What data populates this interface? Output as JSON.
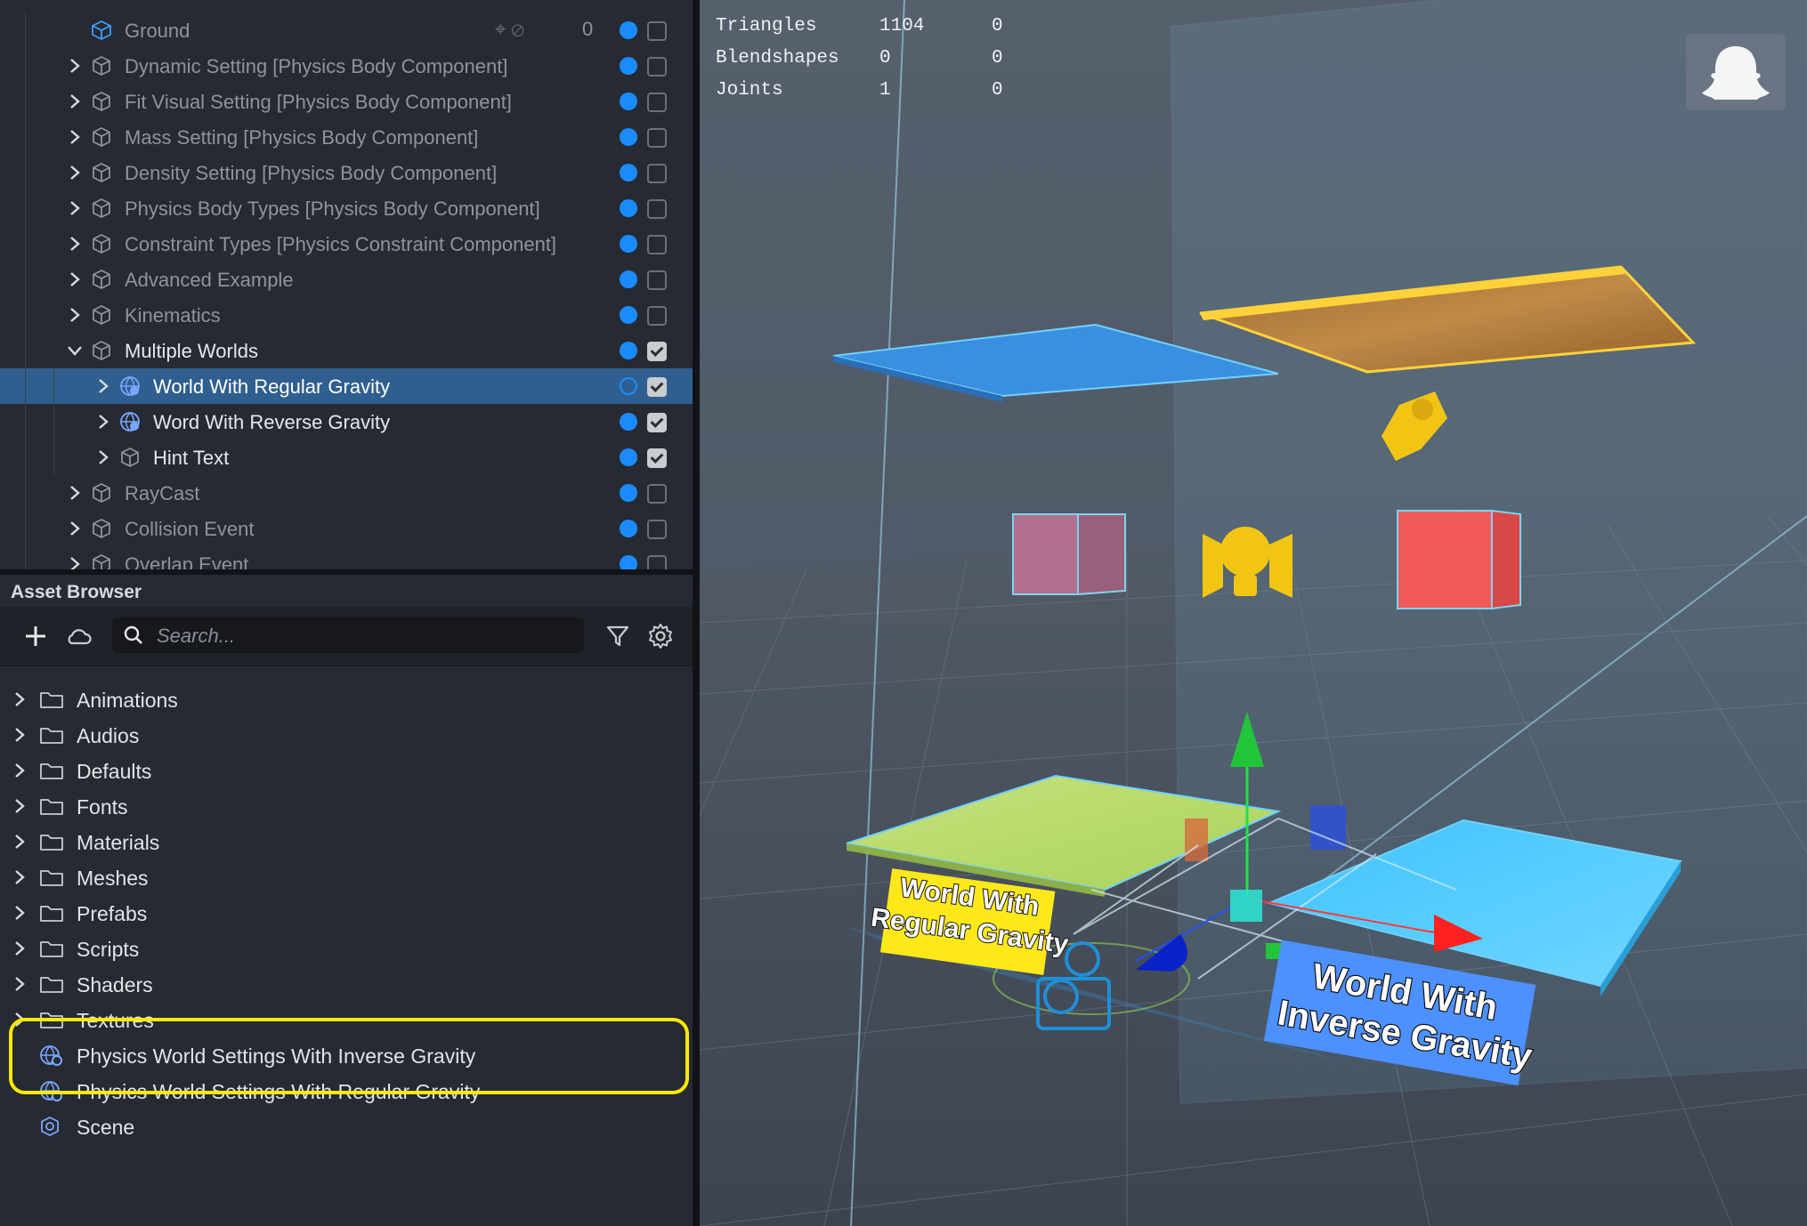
{
  "hierarchy": {
    "rows": [
      {
        "label": "Ground",
        "depth": 1,
        "arrow": "none",
        "icon": "mesh-cube",
        "active": false,
        "count": "0",
        "checked": false
      },
      {
        "label": "Dynamic Setting [Physics Body Component]",
        "depth": 1,
        "arrow": "right",
        "icon": "scene-object",
        "active": false,
        "checked": false
      },
      {
        "label": "Fit Visual Setting [Physics Body Component]",
        "depth": 1,
        "arrow": "right",
        "icon": "scene-object",
        "active": false,
        "checked": false
      },
      {
        "label": "Mass Setting [Physics Body Component]",
        "depth": 1,
        "arrow": "right",
        "icon": "scene-object",
        "active": false,
        "checked": false
      },
      {
        "label": "Density Setting [Physics Body Component]",
        "depth": 1,
        "arrow": "right",
        "icon": "scene-object",
        "active": false,
        "checked": false
      },
      {
        "label": "Physics Body Types [Physics Body Component]",
        "depth": 1,
        "arrow": "right",
        "icon": "scene-object",
        "active": false,
        "checked": false
      },
      {
        "label": "Constraint Types [Physics Constraint Component]",
        "depth": 1,
        "arrow": "right",
        "icon": "scene-object",
        "active": false,
        "checked": false
      },
      {
        "label": "Advanced Example",
        "depth": 1,
        "arrow": "right",
        "icon": "scene-object",
        "active": false,
        "checked": false
      },
      {
        "label": "Kinematics",
        "depth": 1,
        "arrow": "right",
        "icon": "scene-object",
        "active": false,
        "checked": false
      },
      {
        "label": "Multiple Worlds",
        "depth": 1,
        "arrow": "down",
        "icon": "scene-object",
        "active": true,
        "checked": true
      },
      {
        "label": "World With Regular Gravity",
        "depth": 2,
        "arrow": "right",
        "icon": "physics-world",
        "active": true,
        "checked": true,
        "selected": true
      },
      {
        "label": "Word With Reverse Gravity",
        "depth": 2,
        "arrow": "right",
        "icon": "physics-world",
        "active": true,
        "checked": true
      },
      {
        "label": "Hint Text",
        "depth": 2,
        "arrow": "right",
        "icon": "scene-object",
        "active": true,
        "checked": true
      },
      {
        "label": "RayCast",
        "depth": 1,
        "arrow": "right",
        "icon": "scene-object",
        "active": false,
        "checked": false
      },
      {
        "label": "Collision Event",
        "depth": 1,
        "arrow": "right",
        "icon": "scene-object",
        "active": false,
        "checked": false
      },
      {
        "label": "Overlap Event",
        "depth": 1,
        "arrow": "right",
        "icon": "scene-object",
        "active": false,
        "checked": false
      }
    ]
  },
  "asset_browser": {
    "title": "Asset Browser",
    "search_placeholder": "Search...",
    "items": [
      {
        "label": "Animations",
        "type": "folder"
      },
      {
        "label": "Audios",
        "type": "folder"
      },
      {
        "label": "Defaults",
        "type": "folder"
      },
      {
        "label": "Fonts",
        "type": "folder"
      },
      {
        "label": "Materials",
        "type": "folder"
      },
      {
        "label": "Meshes",
        "type": "folder"
      },
      {
        "label": "Prefabs",
        "type": "folder"
      },
      {
        "label": "Scripts",
        "type": "folder"
      },
      {
        "label": "Shaders",
        "type": "folder"
      },
      {
        "label": "Textures",
        "type": "folder"
      },
      {
        "label": "Physics World Settings With Inverse Gravity",
        "type": "physics-settings"
      },
      {
        "label": "Physics World Settings With Regular Gravity",
        "type": "physics-settings"
      },
      {
        "label": "Scene",
        "type": "scene"
      }
    ]
  },
  "viewport": {
    "stats": [
      {
        "name": "Triangles",
        "value": "1104",
        "extra": "0"
      },
      {
        "name": "Blendshapes",
        "value": "0",
        "extra": "0"
      },
      {
        "name": "Joints",
        "value": "1",
        "extra": "0"
      }
    ],
    "label_regular": [
      "World With",
      "Regular Gravity"
    ],
    "label_inverse": [
      "World With",
      "Inverse Gravity"
    ],
    "icons": [
      "snapchat-ghost-icon",
      "light-icon",
      "camera-icon",
      "gizmo-icon"
    ]
  },
  "colors": {
    "selection": "#2f5f8f",
    "accent": "#1a8cff",
    "highlight": "#ffea00",
    "label_yellow": "#ffe81a",
    "label_blue": "#4d90ff"
  }
}
